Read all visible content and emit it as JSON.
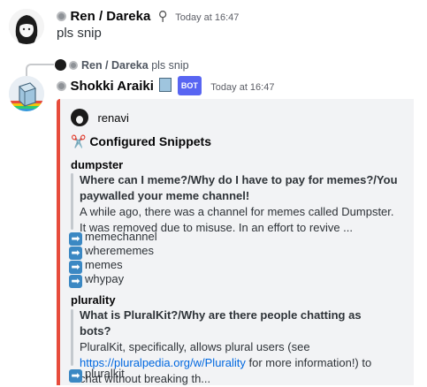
{
  "message1": {
    "author": "Ren / Dareka",
    "timestamp": "Today at 16:47",
    "text": "pls snip"
  },
  "reply": {
    "author": "Ren / Dareka",
    "text": "pls snip"
  },
  "message2": {
    "author": "Shokki Araiki",
    "badge": "BOT",
    "timestamp": "Today at 16:47"
  },
  "embed": {
    "author": "renavi",
    "title_icon": "scissors-icon",
    "title": "✂️ Configured Snippets",
    "accent_color": "#e74c3c",
    "fields": [
      {
        "name": "dumpster",
        "quote_title": "Where can I meme?/Why do I have to pay for memes?/You paywalled your meme channel!",
        "quote_text": "A while ago, there was a channel for memes called Dumpster. It was removed due to misuse. In an effort to revive ...",
        "aliases": [
          "memechannel",
          "wherememes",
          "memes",
          "whypay"
        ]
      },
      {
        "name": "plurality",
        "quote_title": "What is PluralKit?/Why are there people chatting as bots?",
        "quote_text_pre": "PluralKit, specifically, allows plural users (see",
        "quote_link": "https://pluralpedia.org/w/Plurality",
        "quote_text_post": "for more information!) to chat without breaking th...",
        "aliases": [
          "pluralkit"
        ]
      }
    ]
  }
}
